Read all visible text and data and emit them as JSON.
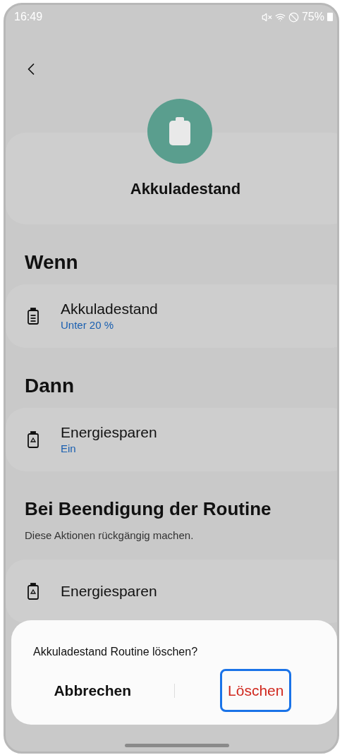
{
  "status_bar": {
    "time": "16:49",
    "battery": "75%"
  },
  "header": {
    "title": "Akkuladestand"
  },
  "sections": [
    {
      "title": "Wenn",
      "items": [
        {
          "kind": "battery",
          "title": "Akkuladestand",
          "value": "Unter 20 %"
        }
      ]
    },
    {
      "title": "Dann",
      "items": [
        {
          "kind": "saver",
          "title": "Energiesparen",
          "value": "Ein"
        }
      ]
    },
    {
      "title": "Bei Beendigung der Routine",
      "subtitle": "Diese Aktionen rückgängig machen.",
      "items": [
        {
          "kind": "saver",
          "title": "Energiesparen"
        }
      ]
    }
  ],
  "dialog": {
    "message": "Akkuladestand Routine löschen?",
    "buttons": [
      {
        "label": "Abbrechen",
        "kind": "cancel",
        "focused": false
      },
      {
        "label": "Löschen",
        "kind": "delete",
        "focused": true
      }
    ]
  }
}
